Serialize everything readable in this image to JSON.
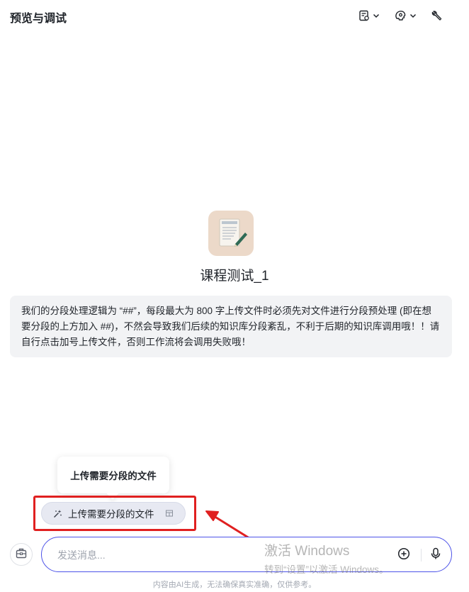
{
  "header": {
    "title": "预览与调试"
  },
  "bot": {
    "name": "课程测试_1",
    "avatar_icon": "document-pen-icon"
  },
  "notice": {
    "text": "我们的分段处理逻辑为 “##”，每段最大为 800 字上传文件时必须先对文件进行分段预处理 (即在想要分段的上方加入 ##)，不然会导致我们后续的知识库分段紊乱，不利于后期的知识库调用哦！！请自行点击加号上传文件，否则工作流将会调用失败哦！"
  },
  "tooltip": {
    "text": "上传需要分段的文件"
  },
  "suggestion_chip": {
    "label": "上传需要分段的文件"
  },
  "input": {
    "placeholder": "发送消息..."
  },
  "watermark": {
    "line1": "激活 Windows",
    "line2": "转到“设置”以激活 Windows。"
  },
  "footer": {
    "text": "内容由AI生成，无法确保真实准确，仅供参考。"
  },
  "colors": {
    "accent": "#4d53e8",
    "highlight": "#e02020",
    "notice_bg": "#f2f3f5",
    "chip_bg": "#e7e9f2"
  }
}
